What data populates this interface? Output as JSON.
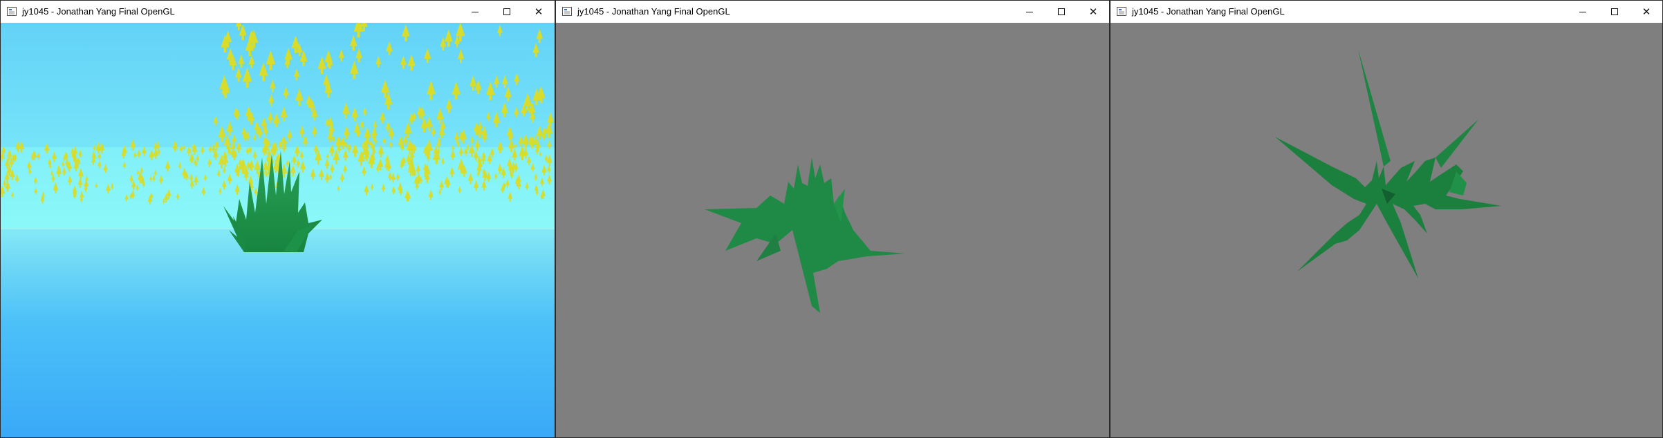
{
  "windows": [
    {
      "title": "jy1045 - Jonathan Yang Final OpenGL",
      "scene": "perspective",
      "sky_top_color": "#63d2f7",
      "sky_horizon_color": "#8cfaf8",
      "water_top_color": "#7fdff5",
      "water_bottom_color": "#3aaefa",
      "plant_color": "#1d8f48",
      "tree_color": "#d8dc2a"
    },
    {
      "title": "jy1045 - Jonathan Yang Final OpenGL",
      "scene": "orbit",
      "background_color": "#7f7f7f",
      "plant_color": "#1f8a45"
    },
    {
      "title": "jy1045 - Jonathan Yang Final OpenGL",
      "scene": "top-down",
      "background_color": "#7f7f7f",
      "plant_color": "#1b7f3e"
    }
  ],
  "controls": {
    "minimize_icon": "minimize-icon",
    "maximize_icon": "maximize-icon",
    "close_icon": "close-icon",
    "close_glyph": "✕"
  }
}
